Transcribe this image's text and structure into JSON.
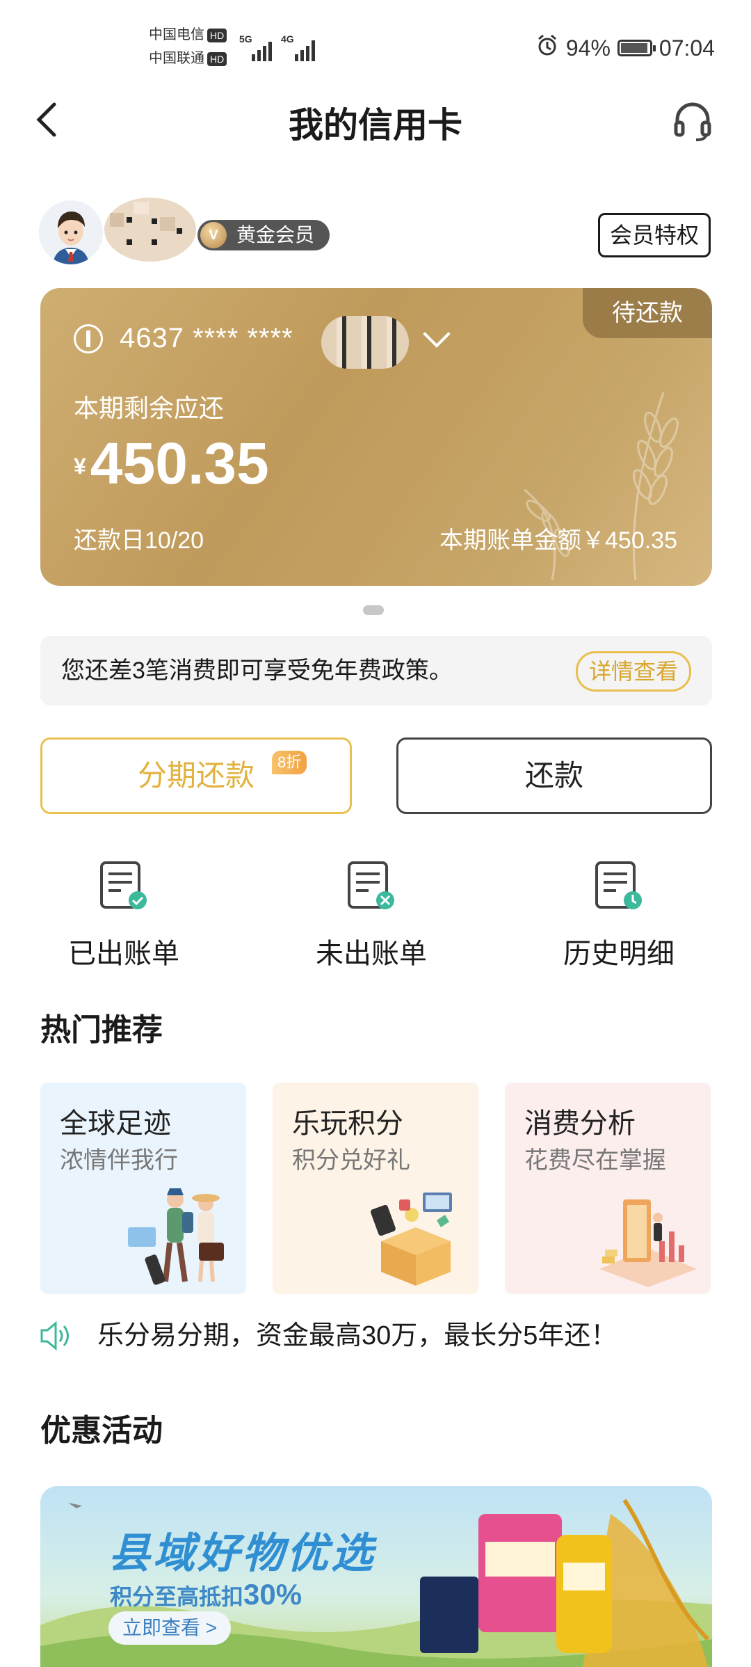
{
  "status_bar": {
    "carrier1": "中国电信",
    "carrier2": "中国联通",
    "hd": "HD",
    "net1": "5G",
    "net2": "4G",
    "battery": "94%",
    "battery_level": 0.94,
    "time": "07:04"
  },
  "header": {
    "title": "我的信用卡"
  },
  "user": {
    "level_badge": "黄金会员",
    "badge_letter": "V",
    "privilege_button": "会员特权"
  },
  "card": {
    "status_tag": "待还款",
    "number": "4637 **** ****",
    "remaining_label": "本期剩余应还",
    "currency": "¥",
    "remaining_amount": "450.35",
    "due_date": "还款日10/20",
    "bill_amount": "本期账单金额￥450.35"
  },
  "notice": {
    "text": "您还差3笔消费即可享受免年费政策。",
    "detail_button": "详情查看"
  },
  "actions": {
    "installment": "分期还款",
    "installment_tag": "8折",
    "repay": "还款"
  },
  "quick_links": [
    {
      "label": "已出账单",
      "icon": "bill-issued-icon"
    },
    {
      "label": "未出账单",
      "icon": "bill-unissued-icon"
    },
    {
      "label": "历史明细",
      "icon": "history-icon"
    }
  ],
  "hot": {
    "title": "热门推荐",
    "cards": [
      {
        "title": "全球足迹",
        "subtitle": "浓情伴我行"
      },
      {
        "title": "乐玩积分",
        "subtitle": "积分兑好礼"
      },
      {
        "title": "消费分析",
        "subtitle": "花费尽在掌握"
      }
    ]
  },
  "ticker": {
    "text": "乐分易分期，资金最高30万，最长分5年还！"
  },
  "offers": {
    "title": "优惠活动",
    "banner_title": "县域好物优选",
    "banner_subtitle_prefix": "积分至高抵扣",
    "banner_subtitle_value": "30%",
    "banner_button": "立即查看 >"
  },
  "colors": {
    "gold": "#c7a669",
    "accent": "#e2b23e",
    "teal": "#3cb89a"
  }
}
